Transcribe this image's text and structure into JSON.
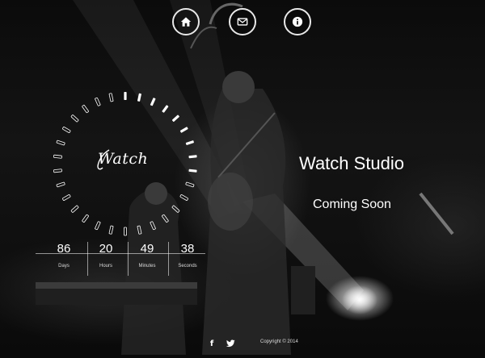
{
  "nav": {
    "items": [
      {
        "name": "home",
        "icon": "home-icon"
      },
      {
        "name": "contact",
        "icon": "envelope-icon"
      },
      {
        "name": "info",
        "icon": "info-icon"
      }
    ]
  },
  "brand": {
    "logo_text": "Watch"
  },
  "countdown": {
    "days": {
      "value": "86",
      "label": "Days"
    },
    "hours": {
      "value": "20",
      "label": "Hours"
    },
    "minutes": {
      "value": "49",
      "label": "Minutes"
    },
    "seconds": {
      "value": "38",
      "label": "Seconds"
    }
  },
  "hero": {
    "title": "Watch Studio",
    "subtitle": "Coming Soon"
  },
  "footer": {
    "social": [
      {
        "name": "facebook",
        "icon": "facebook-icon",
        "glyph": "f"
      },
      {
        "name": "twitter",
        "icon": "twitter-icon"
      }
    ],
    "copyright": "Copyright © 2014"
  },
  "colors": {
    "accent": "#ffffff",
    "background": "#000000"
  },
  "clock": {
    "total_ticks": 30,
    "active_ticks": 9
  }
}
